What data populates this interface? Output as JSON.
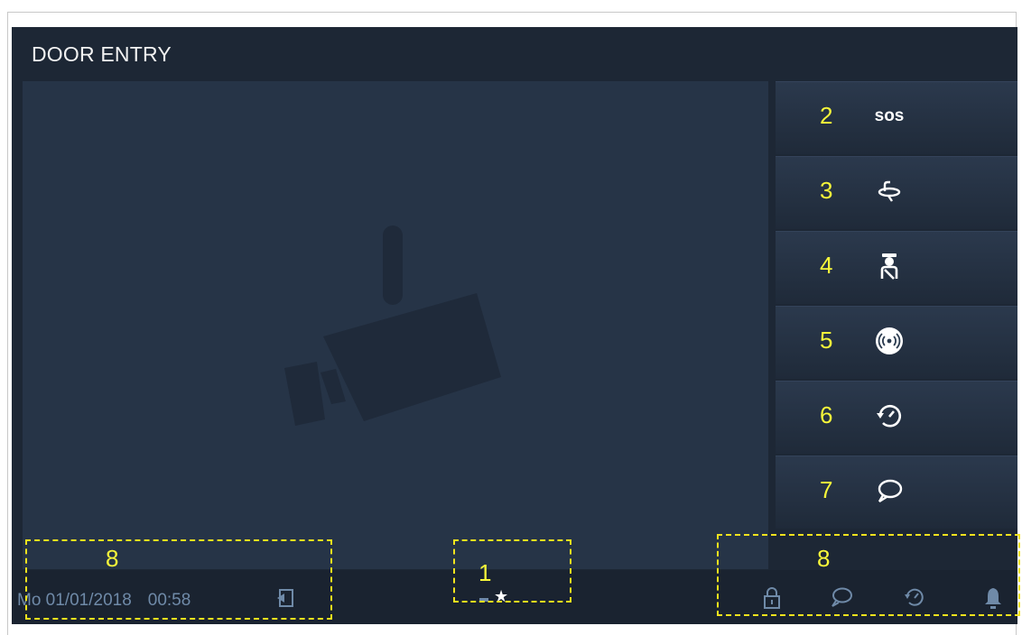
{
  "screen": {
    "title": "DOOR ENTRY"
  },
  "sidebar": {
    "buttons": [
      {
        "num": "2",
        "icon": "sos-icon",
        "text": "sos"
      },
      {
        "num": "3",
        "icon": "surveillance-icon"
      },
      {
        "num": "4",
        "icon": "guard-unit-icon"
      },
      {
        "num": "5",
        "icon": "intercom-icon"
      },
      {
        "num": "6",
        "icon": "history-icon"
      },
      {
        "num": "7",
        "icon": "message-icon"
      }
    ]
  },
  "statusbar": {
    "date": "Mo 01/01/2018",
    "time": "00:58",
    "callouts": {
      "left": "8",
      "center": "1",
      "right": "8"
    },
    "icons": [
      "door-exit-icon",
      "lock-icon",
      "message-icon",
      "history-icon",
      "bell-icon"
    ]
  },
  "colors": {
    "background": "#1d2735",
    "video": "#263447",
    "callout": "#f7f73a",
    "dashes": "#f2e31d",
    "datetime": "#6f8aa8"
  }
}
